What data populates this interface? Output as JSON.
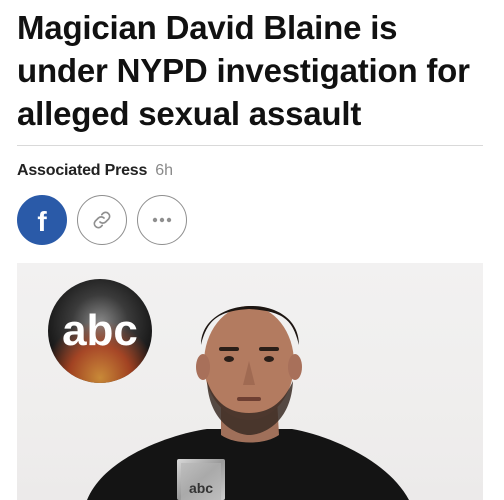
{
  "article": {
    "headline": "Magician David Blaine is under NYPD investigation for alleged sexual assault",
    "source": "Associated Press",
    "time": "6h"
  },
  "share": {
    "facebook_glyph": "f",
    "buttons": [
      {
        "icon": "facebook-icon"
      },
      {
        "icon": "link-icon"
      },
      {
        "icon": "more-horizontal-icon"
      }
    ]
  },
  "photo": {
    "logo_text": "abc",
    "plaque_text": "abc"
  },
  "colors": {
    "facebook": "#2a5aa8",
    "headline": "#111111",
    "timestamp": "#8a8a8a",
    "divider": "#d9d9d9"
  }
}
